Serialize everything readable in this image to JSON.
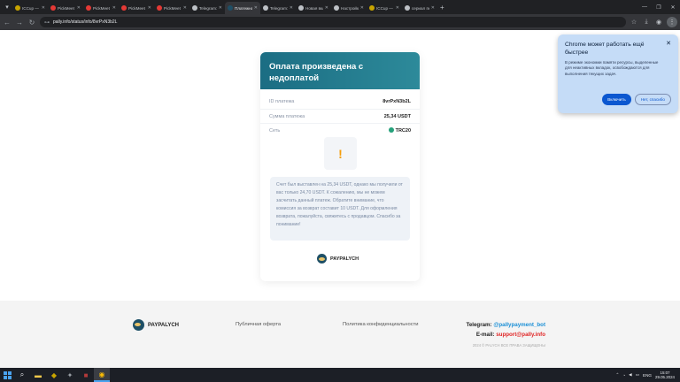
{
  "browser": {
    "tabs": [
      {
        "title": "ICCup — По",
        "color": "#c8a400"
      },
      {
        "title": "PickMeet - Бе",
        "color": "#e53935"
      },
      {
        "title": "PickMeet - Бе",
        "color": "#e53935"
      },
      {
        "title": "PickMeet - Бе",
        "color": "#e53935"
      },
      {
        "title": "PickMeet - Бе",
        "color": "#e53935"
      },
      {
        "title": "Telegram: Vi",
        "color": "#bdc1c6"
      },
      {
        "title": "Платежная",
        "color": "#1e4f66"
      },
      {
        "title": "Telegram: L",
        "color": "#bdc1c6"
      },
      {
        "title": "Новая вкла",
        "color": "#bdc1c6"
      },
      {
        "title": "Настройки",
        "color": "#bdc1c6"
      },
      {
        "title": "ICCup — Бл",
        "color": "#c8a400"
      },
      {
        "title": "сериал пере",
        "color": "#bdc1c6"
      }
    ],
    "url": "pally.info/status/info/8vrPxN3b2L"
  },
  "card": {
    "title": "Оплата произведена с недоплатой",
    "rows": [
      {
        "label": "ID платежа",
        "value": "8vrPxN3b2L"
      },
      {
        "label": "Сумма платежа",
        "value": "25,34 USDT"
      },
      {
        "label": "Сеть",
        "value": "TRC20"
      }
    ],
    "warning_glyph": "!",
    "message": "Счет был выставлен на 25,34 USDT, однако мы получили от вас только 24,70 USDT. К сожалению, мы не можем засчитать данный платеж. Обратите внимание, что комиссия за возврат составит 10 USDT. Для оформления возврата, пожалуйста, свяжитесь с продавцом. Спасибо за понимание!",
    "brand": "PAYPALYCH"
  },
  "footer": {
    "brand": "PAYPALYCH",
    "offer_link": "Публичная оферта",
    "privacy_link": "Политика конфиденциальности",
    "telegram_label": "Telegram:",
    "telegram_value": "@pallypayment_bot",
    "email_label": "E-mail:",
    "email_value": "support@pally.info",
    "copyright": "2024 © PALYCH ВСЕ ПРАВА ЗАЩИЩЕНЫ"
  },
  "popup": {
    "title": "Chrome может работать ещё быстрее",
    "body": "В режиме экономии памяти ресурсы, выделенные для неактивных вкладок, освобождаются для выполнения текущих задач.",
    "enable": "Включить",
    "decline": "Нет, спасибо"
  },
  "taskbar": {
    "lang": "ENG",
    "time": "15:07",
    "date": "29.05.2024"
  },
  "colors": {
    "accent": "#1b6d83",
    "warning": "#f59e0b",
    "chrome_button": "#0b57d0"
  }
}
